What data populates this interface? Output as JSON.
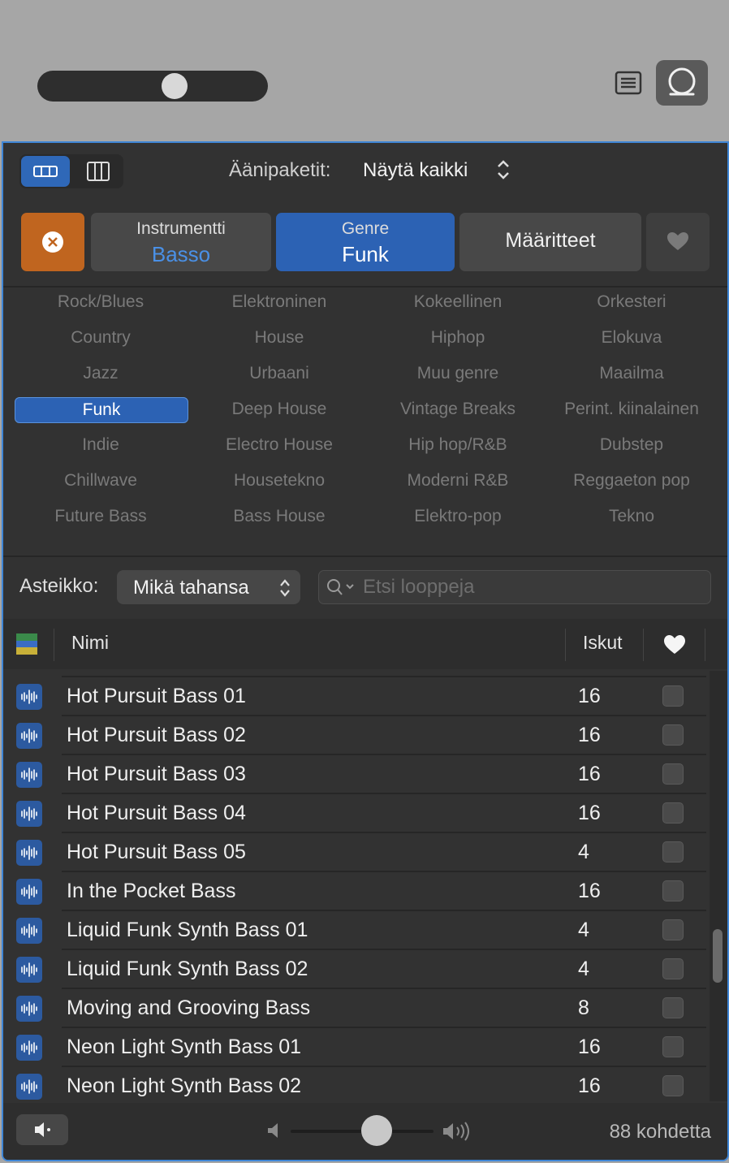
{
  "colors": {
    "accent": "#2c62b4",
    "clear": "#c0651f",
    "panel": "#323232",
    "border": "#3f86d6"
  },
  "toolbar": {
    "zoom_level": 0.62
  },
  "header": {
    "packs_label": "Äänipaketit:",
    "packs_value": "Näytä kaikki"
  },
  "filters": {
    "instrument_title": "Instrumentti",
    "instrument_value": "Basso",
    "genre_title": "Genre",
    "genre_value": "Funk",
    "attributes_label": "Määritteet"
  },
  "genres": [
    [
      "Rock/Blues",
      "Elektroninen",
      "Kokeellinen",
      "Orkesteri"
    ],
    [
      "Country",
      "House",
      "Hiphop",
      "Elokuva"
    ],
    [
      "Jazz",
      "Urbaani",
      "Muu genre",
      "Maailma"
    ],
    [
      "Funk",
      "Deep House",
      "Vintage Breaks",
      "Perint. kiinalainen"
    ],
    [
      "Indie",
      "Electro House",
      "Hip hop/R&B",
      "Dubstep"
    ],
    [
      "Chillwave",
      "Housetekno",
      "Moderni R&B",
      "Reggaeton pop"
    ],
    [
      "Future Bass",
      "Bass House",
      "Elektro-pop",
      "Tekno"
    ]
  ],
  "selected_genre": "Funk",
  "scale": {
    "label": "Asteikko:",
    "value": "Mikä tahansa"
  },
  "search": {
    "placeholder": "Etsi looppeja"
  },
  "table": {
    "col_name": "Nimi",
    "col_beats": "Iskut",
    "rows": [
      {
        "name": "Hot Pursuit Bass 01",
        "beats": "16"
      },
      {
        "name": "Hot Pursuit Bass 02",
        "beats": "16"
      },
      {
        "name": "Hot Pursuit Bass 03",
        "beats": "16"
      },
      {
        "name": "Hot Pursuit Bass 04",
        "beats": "16"
      },
      {
        "name": "Hot Pursuit Bass 05",
        "beats": "4"
      },
      {
        "name": "In the Pocket Bass",
        "beats": "16"
      },
      {
        "name": "Liquid Funk Synth Bass 01",
        "beats": "4"
      },
      {
        "name": "Liquid Funk Synth Bass 02",
        "beats": "4"
      },
      {
        "name": "Moving and Grooving Bass",
        "beats": "8"
      },
      {
        "name": "Neon Light Synth Bass 01",
        "beats": "16"
      },
      {
        "name": "Neon Light Synth Bass 02",
        "beats": "16"
      }
    ]
  },
  "footer": {
    "count": "88 kohdetta",
    "volume": 0.6
  }
}
